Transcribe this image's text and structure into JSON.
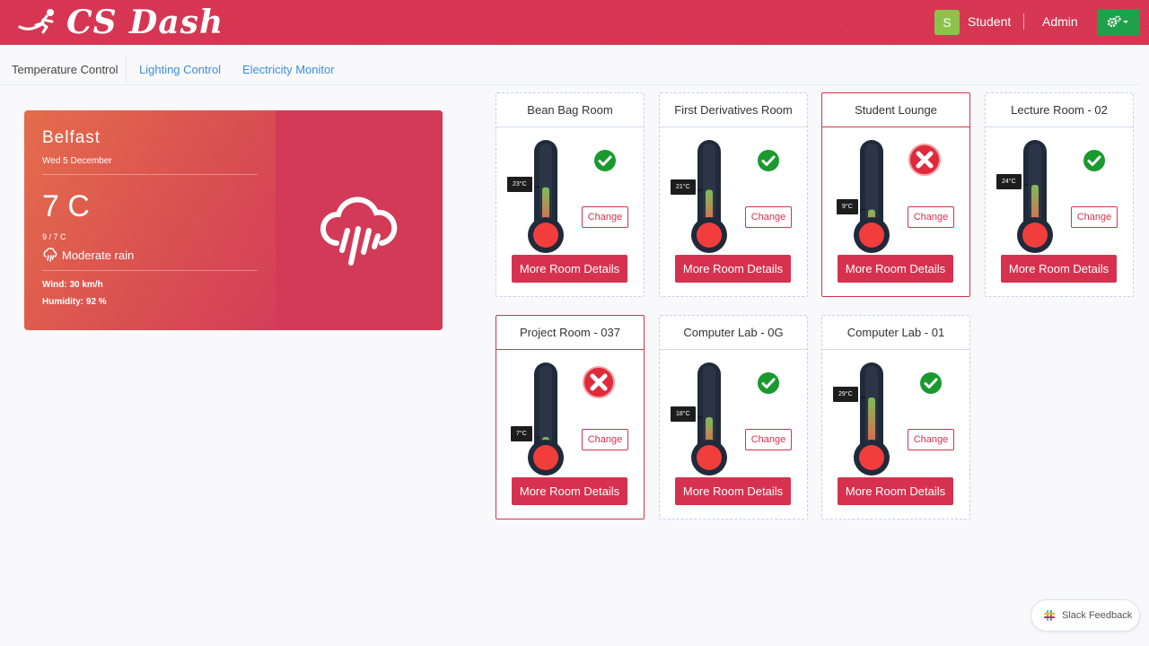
{
  "header": {
    "logo_text": "CS Dash",
    "avatar_initial": "S",
    "user_name": "Student",
    "admin_label": "Admin",
    "brand_color": "#d6324f"
  },
  "tabs": [
    {
      "label": "Temperature Control",
      "active": true
    },
    {
      "label": "Lighting Control",
      "active": false
    },
    {
      "label": "Electricity Monitor",
      "active": false
    }
  ],
  "weather": {
    "city": "Belfast",
    "date": "Wed 5 December",
    "temperature": "7 C",
    "range": "9 / 7 C",
    "condition": "Moderate rain",
    "wind": "Wind: 30 km/h",
    "humidity": "Humidity: 92 %"
  },
  "rooms": [
    {
      "name": "Bean Bag Room",
      "temp": "23°C",
      "level": 0.47,
      "status": "ok",
      "change_label": "Change",
      "details_label": "More Room Details"
    },
    {
      "name": "First Derivatives Room",
      "temp": "21°C",
      "level": 0.44,
      "status": "ok",
      "change_label": "Change",
      "details_label": "More Room Details"
    },
    {
      "name": "Student Lounge",
      "temp": "9°C",
      "level": 0.2,
      "status": "error",
      "change_label": "Change",
      "details_label": "More Room Details"
    },
    {
      "name": "Lecture Room - 02",
      "temp": "24°C",
      "level": 0.5,
      "status": "ok",
      "change_label": "Change",
      "details_label": "More Room Details"
    },
    {
      "name": "Project Room - 037",
      "temp": "7°C",
      "level": 0.14,
      "status": "error",
      "change_label": "Change",
      "details_label": "More Room Details"
    },
    {
      "name": "Computer Lab - 0G",
      "temp": "18°C",
      "level": 0.38,
      "status": "ok",
      "change_label": "Change",
      "details_label": "More Room Details"
    },
    {
      "name": "Computer Lab - 01",
      "temp": "29°C",
      "level": 0.62,
      "status": "ok",
      "change_label": "Change",
      "details_label": "More Room Details"
    }
  ],
  "slack": {
    "label": "Slack Feedback"
  },
  "colors": {
    "ok": "#1a9a2e",
    "error": "#e02a3a",
    "accent": "#d6324f",
    "link": "#3a8ee0"
  }
}
